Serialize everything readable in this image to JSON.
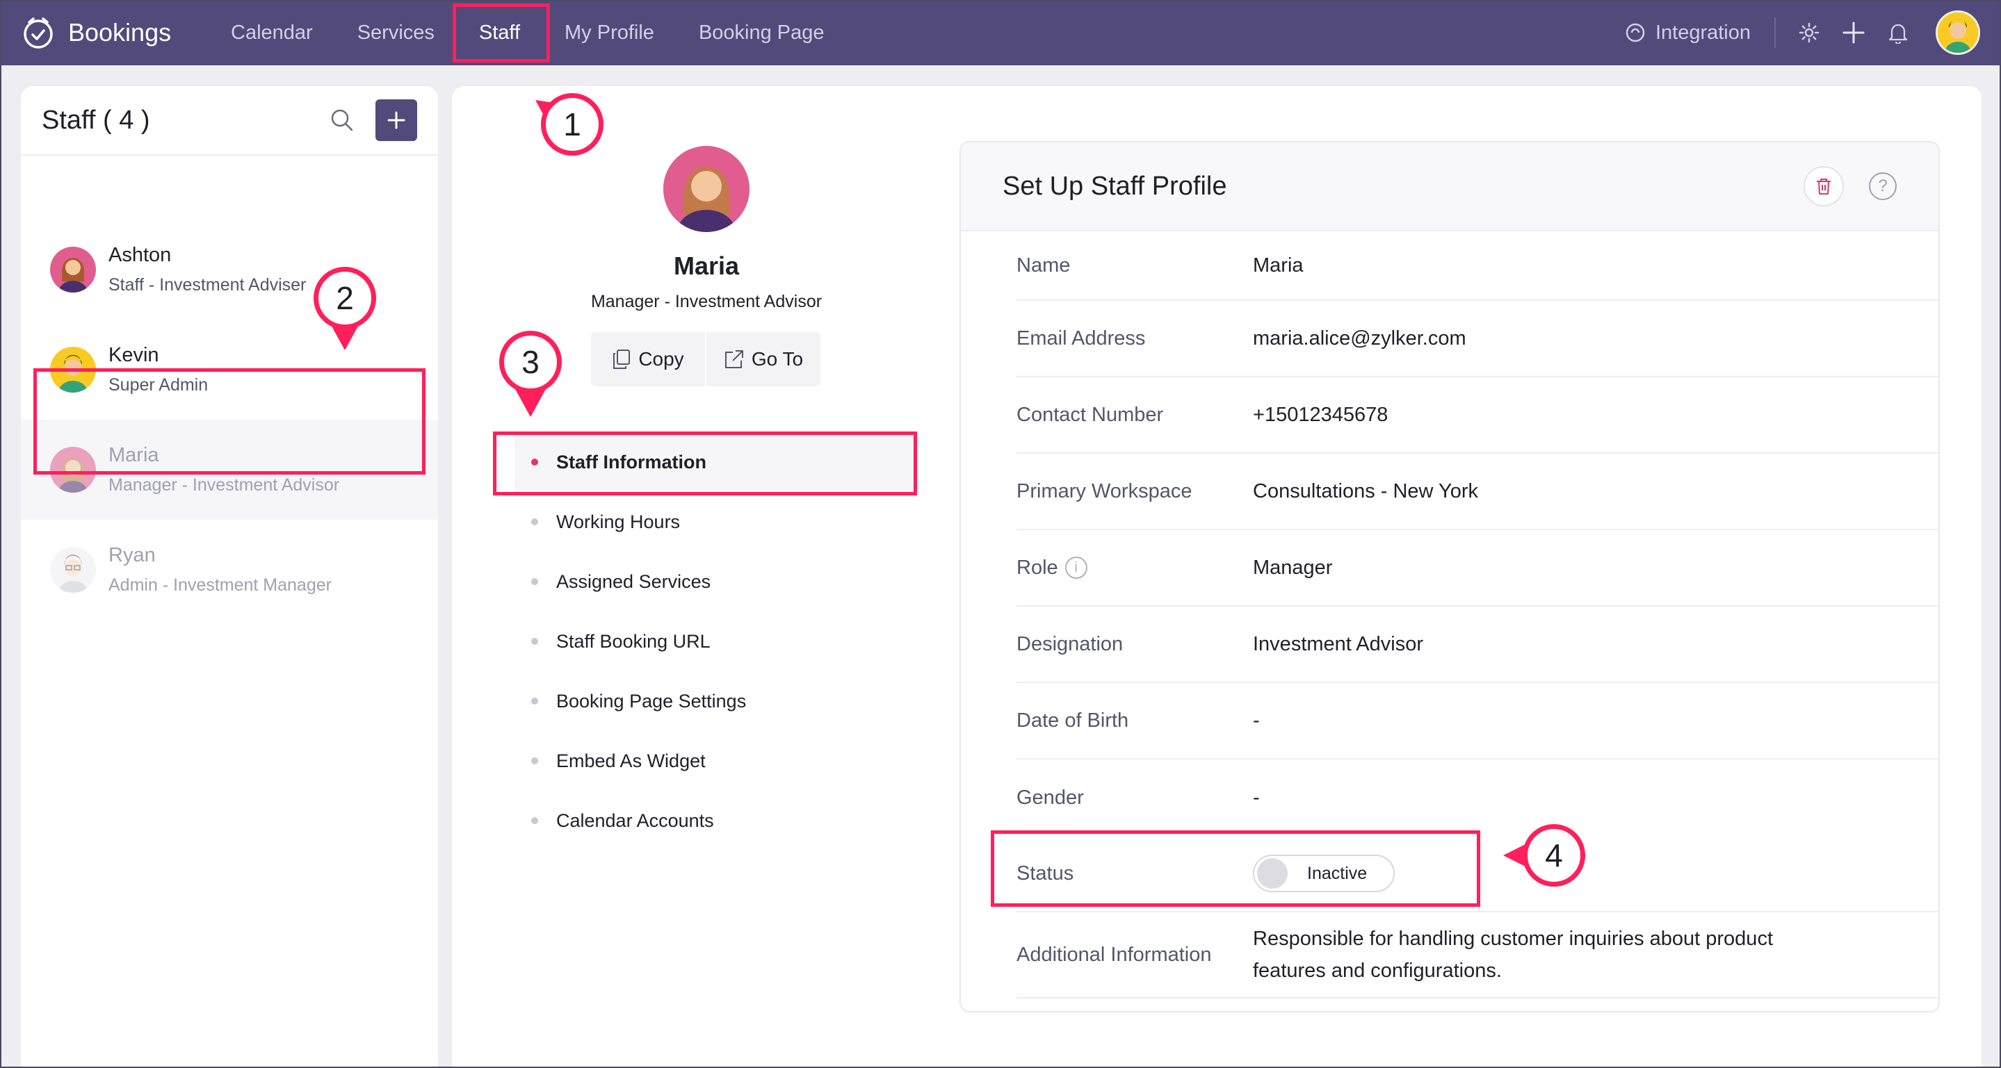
{
  "app": {
    "name": "Bookings"
  },
  "nav": {
    "items": [
      {
        "label": "Calendar"
      },
      {
        "label": "Services"
      },
      {
        "label": "Staff"
      },
      {
        "label": "My Profile"
      },
      {
        "label": "Booking Page"
      }
    ],
    "active": "Staff",
    "integration_label": "Integration"
  },
  "staff_list": {
    "title": "Staff ( 4 )",
    "members": [
      {
        "name": "Ashton",
        "role": "Staff - Investment Adviser"
      },
      {
        "name": "Kevin",
        "role": "Super Admin"
      },
      {
        "name": "Maria",
        "role": "Manager - Investment Advisor"
      },
      {
        "name": "Ryan",
        "role": "Admin - Investment Manager"
      }
    ]
  },
  "profile": {
    "name": "Maria",
    "role": "Manager - Investment Advisor",
    "copy_label": "Copy",
    "goto_label": "Go To"
  },
  "menu": {
    "items": [
      "Staff Information",
      "Working Hours",
      "Assigned Services",
      "Staff Booking URL",
      "Booking Page Settings",
      "Embed As Widget",
      "Calendar Accounts"
    ],
    "active": "Staff Information"
  },
  "card": {
    "title": "Set Up Staff Profile",
    "fields": [
      {
        "label": "Name",
        "value": "Maria"
      },
      {
        "label": "Email Address",
        "value": "maria.alice@zylker.com"
      },
      {
        "label": "Contact Number",
        "value": "+15012345678"
      },
      {
        "label": "Primary Workspace",
        "value": "Consultations - New York"
      },
      {
        "label": "Role",
        "value": "Manager"
      },
      {
        "label": "Designation",
        "value": "Investment Advisor"
      },
      {
        "label": "Date of Birth",
        "value": "-"
      },
      {
        "label": "Gender",
        "value": "-"
      },
      {
        "label": "Status",
        "value": "Inactive"
      },
      {
        "label": "Additional Information",
        "value": "Responsible for handling customer inquiries about product features and configurations."
      }
    ],
    "status_toggle_on": false
  },
  "callouts": [
    "1",
    "2",
    "3",
    "4"
  ],
  "colors": {
    "topbar": "#514a7a",
    "highlight": "#ff1f5a",
    "active_dot": "#e2356a"
  },
  "icons": [
    "bookings-logo-icon",
    "integration-icon",
    "gear-icon",
    "plus-icon",
    "bell-icon",
    "search-icon",
    "copy-icon",
    "external-link-icon",
    "trash-icon",
    "help-icon",
    "info-icon"
  ]
}
